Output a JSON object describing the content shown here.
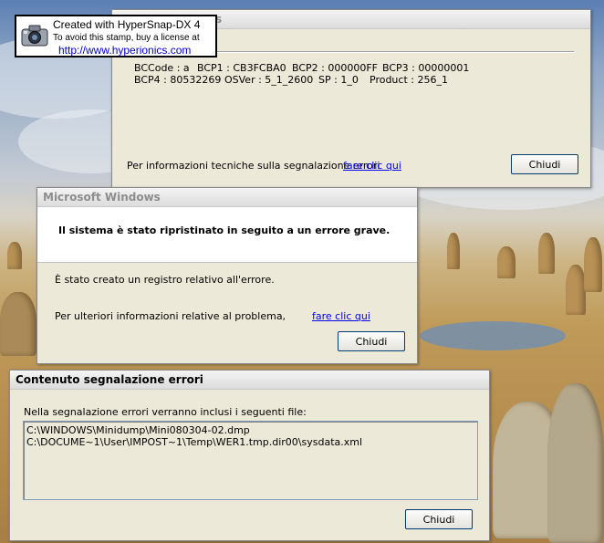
{
  "stamp": {
    "line1": "Created with HyperSnap-DX 4",
    "line2": "To avoid this stamp, buy a license at",
    "url": "http://www.hyperionics.com"
  },
  "details_window": {
    "title_fragment": "s",
    "bccode": "BCCode : a",
    "bcp1": "BCP1 : CB3FCBA0",
    "bcp2": "BCP2 : 000000FF",
    "bcp3": "BCP3 : 00000001",
    "bcp4": "BCP4 : 80532269",
    "osver": "OSVer : 5_1_2600",
    "sp": "SP : 1_0",
    "product": "Product : 256_1",
    "info_text": "Per informazioni tecniche sulla segnalazione errori",
    "info_link": "fare clic qui",
    "close_label": "Chiudi"
  },
  "mswindows_dialog": {
    "title": "Microsoft Windows",
    "headline": "Il sistema è stato ripristinato in seguito a un errore grave.",
    "log_text": "È stato creato un registro relativo all'errore.",
    "more_info_text": "Per ulteriori informazioni relative al problema,",
    "more_info_link": "fare clic qui",
    "close_label": "Chiudi"
  },
  "report_window": {
    "title": "Contenuto segnalazione errori",
    "intro": "Nella segnalazione errori verranno inclusi i seguenti file:",
    "files": [
      "C:\\WINDOWS\\Minidump\\Mini080304-02.dmp",
      "C:\\DOCUME~1\\User\\IMPOST~1\\Temp\\WER1.tmp.dir00\\sysdata.xml"
    ],
    "close_label": "Chiudi"
  }
}
